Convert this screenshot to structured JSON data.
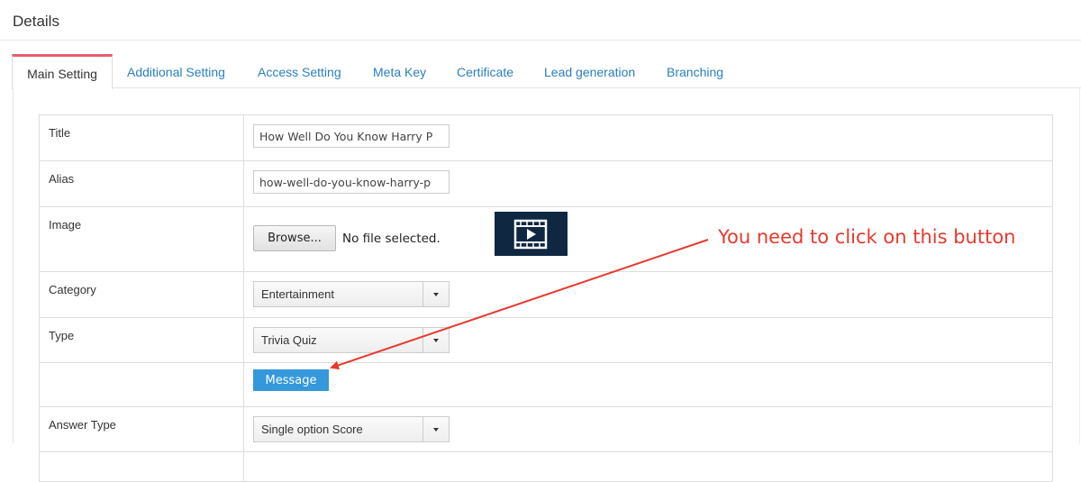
{
  "page": {
    "title": "Details"
  },
  "tabs": [
    {
      "label": "Main Setting",
      "active": true
    },
    {
      "label": "Additional Setting"
    },
    {
      "label": "Access Setting"
    },
    {
      "label": "Meta Key"
    },
    {
      "label": "Certificate"
    },
    {
      "label": "Lead generation"
    },
    {
      "label": "Branching"
    }
  ],
  "form": {
    "title": {
      "label": "Title",
      "value": "How Well Do You Know Harry P"
    },
    "alias": {
      "label": "Alias",
      "value": "how-well-do-you-know-harry-p"
    },
    "image": {
      "label": "Image",
      "browse_label": "Browse...",
      "file_status": "No file selected.",
      "thumbnail_icon": "video-icon"
    },
    "category": {
      "label": "Category",
      "value": "Entertainment"
    },
    "type": {
      "label": "Type",
      "value": "Trivia Quiz"
    },
    "message_button": "Message",
    "answer_type": {
      "label": "Answer Type",
      "value": "Single option Score"
    }
  },
  "annotation": {
    "text": "You need to click on this button",
    "color": "#e63a2e"
  },
  "colors": {
    "accent": "#3498db",
    "active_tab": "#e4606d",
    "link": "#2a7fc1"
  }
}
